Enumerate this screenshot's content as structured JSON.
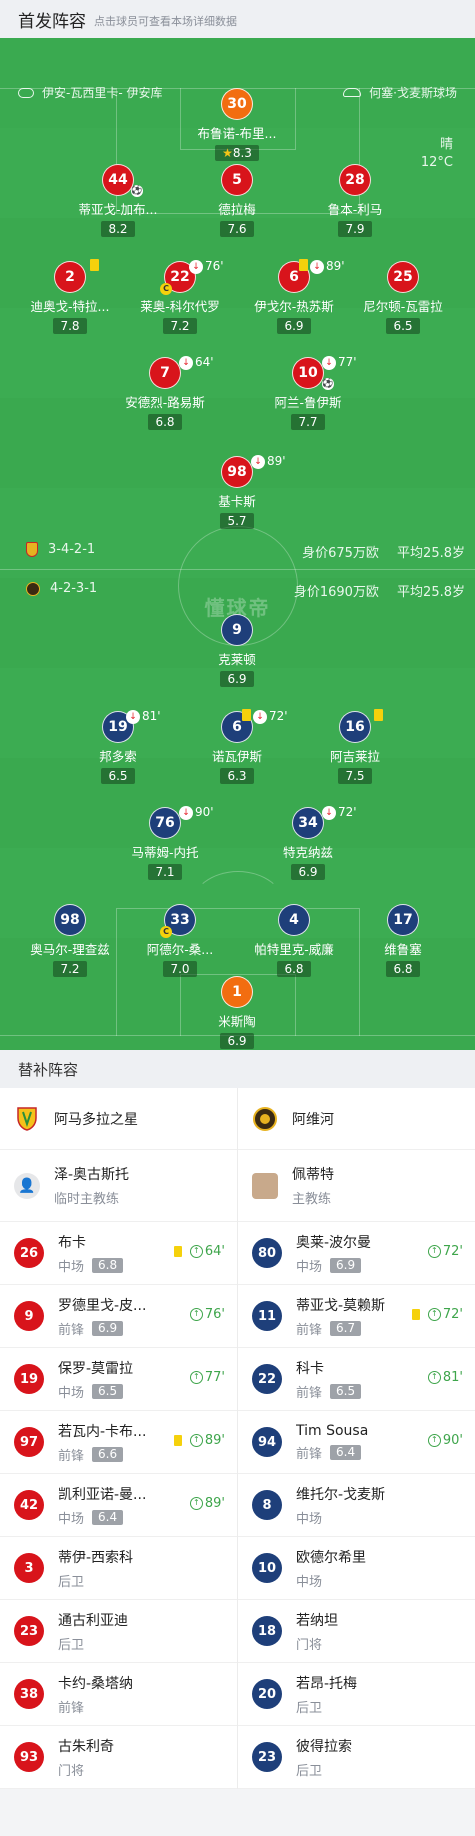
{
  "header": {
    "title": "首发阵容",
    "hint": "点击球员可查看本场详细数据"
  },
  "venue": {
    "home_venue": "伊安-瓦西里卡- 伊安库",
    "away_venue": "何塞·戈麦斯球场"
  },
  "weather": {
    "condition": "晴",
    "temp": "12°C"
  },
  "watermark": "懂球帝",
  "home_team_info": {
    "formation": "3-4-2-1",
    "value": "身价675万欧",
    "avg_age": "平均25.8岁"
  },
  "away_team_info": {
    "formation": "4-2-3-1",
    "value": "身价1690万欧",
    "avg_age": "平均25.8岁"
  },
  "home_players": [
    {
      "number": "30",
      "name": "布鲁诺-布里...",
      "rating": "8.3",
      "color": "orange",
      "star": true
    },
    {
      "number": "44",
      "name": "蒂亚戈-加布...",
      "rating": "8.2",
      "color": "red"
    },
    {
      "number": "5",
      "name": "德拉梅",
      "rating": "7.6",
      "color": "red"
    },
    {
      "number": "28",
      "name": "鲁本-利马",
      "rating": "7.9",
      "color": "red"
    },
    {
      "number": "2",
      "name": "迪奥戈-特拉...",
      "rating": "7.8",
      "color": "red"
    },
    {
      "number": "22",
      "name": "莱奥-科尔代罗",
      "rating": "7.2",
      "color": "red",
      "sub_min": "76'"
    },
    {
      "number": "6",
      "name": "伊戈尔-热苏斯",
      "rating": "6.9",
      "color": "red",
      "sub_min": "89'"
    },
    {
      "number": "25",
      "name": "尼尔顿-瓦雷拉",
      "rating": "6.5",
      "color": "red"
    },
    {
      "number": "7",
      "name": "安德烈-路易斯",
      "rating": "6.8",
      "color": "red",
      "sub_min": "64'"
    },
    {
      "number": "10",
      "name": "阿兰-鲁伊斯",
      "rating": "7.7",
      "color": "red",
      "sub_min": "77'"
    },
    {
      "number": "98",
      "name": "基卡斯",
      "rating": "5.7",
      "color": "red",
      "sub_min": "89'"
    }
  ],
  "away_players": [
    {
      "number": "9",
      "name": "克莱顿",
      "rating": "6.9",
      "color": "blue"
    },
    {
      "number": "19",
      "name": "邦多索",
      "rating": "6.5",
      "color": "blue",
      "sub_min": "81'"
    },
    {
      "number": "6",
      "name": "诺瓦伊斯",
      "rating": "6.3",
      "color": "blue",
      "sub_min": "72'"
    },
    {
      "number": "16",
      "name": "阿吉莱拉",
      "rating": "7.5",
      "color": "blue"
    },
    {
      "number": "76",
      "name": "马蒂姆-内托",
      "rating": "7.1",
      "color": "blue",
      "sub_min": "90'"
    },
    {
      "number": "34",
      "name": "特克纳兹",
      "rating": "6.9",
      "color": "blue",
      "sub_min": "72'"
    },
    {
      "number": "98",
      "name": "奥马尔-理查兹",
      "rating": "7.2",
      "color": "blue"
    },
    {
      "number": "33",
      "name": "阿德尔-桑...",
      "rating": "7.0",
      "color": "blue"
    },
    {
      "number": "4",
      "name": "帕特里克-威廉",
      "rating": "6.8",
      "color": "blue"
    },
    {
      "number": "17",
      "name": "维鲁塞",
      "rating": "6.8",
      "color": "blue"
    },
    {
      "number": "1",
      "name": "米斯陶",
      "rating": "6.9",
      "color": "orange"
    }
  ],
  "subs_header": "替补阵容",
  "home_subs": {
    "team": "阿马多拉之星",
    "coach": {
      "name": "泽-奥古斯托",
      "role": "临时主教练"
    },
    "players": [
      {
        "number": "26",
        "name": "布卡",
        "pos": "中场",
        "rating": "6.8",
        "yellow": true,
        "in": "64'"
      },
      {
        "number": "9",
        "name": "罗德里戈-皮...",
        "pos": "前锋",
        "rating": "6.9",
        "in": "76'"
      },
      {
        "number": "19",
        "name": "保罗-莫雷拉",
        "pos": "中场",
        "rating": "6.5",
        "in": "77'"
      },
      {
        "number": "97",
        "name": "若瓦内-卡布...",
        "pos": "前锋",
        "rating": "6.6",
        "yellow": true,
        "in": "89'"
      },
      {
        "number": "42",
        "name": "凯利亚诺-曼...",
        "pos": "中场",
        "rating": "6.4",
        "in": "89'"
      },
      {
        "number": "3",
        "name": "蒂伊-西索科",
        "pos": "后卫"
      },
      {
        "number": "23",
        "name": "通古利亚迪",
        "pos": "后卫"
      },
      {
        "number": "38",
        "name": "卡约-桑塔纳",
        "pos": "前锋"
      },
      {
        "number": "93",
        "name": "古朱利奇",
        "pos": "门将"
      }
    ]
  },
  "away_subs": {
    "team": "阿维河",
    "coach": {
      "name": "佩蒂特",
      "role": "主教练"
    },
    "players": [
      {
        "number": "80",
        "name": "奥莱-波尔曼",
        "pos": "中场",
        "rating": "6.9",
        "in": "72'"
      },
      {
        "number": "11",
        "name": "蒂亚戈-莫赖斯",
        "pos": "前锋",
        "rating": "6.7",
        "yellow": true,
        "in": "72'"
      },
      {
        "number": "22",
        "name": "科卡",
        "pos": "前锋",
        "rating": "6.5",
        "in": "81'"
      },
      {
        "number": "94",
        "name": "Tim Sousa",
        "pos": "前锋",
        "rating": "6.4",
        "in": "90'"
      },
      {
        "number": "8",
        "name": "维托尔-戈麦斯",
        "pos": "中场"
      },
      {
        "number": "10",
        "name": "欧德尔希里",
        "pos": "中场"
      },
      {
        "number": "18",
        "name": "若纳坦",
        "pos": "门将"
      },
      {
        "number": "20",
        "name": "若昂-托梅",
        "pos": "后卫"
      },
      {
        "number": "23",
        "name": "彼得拉索",
        "pos": "后卫"
      }
    ]
  }
}
